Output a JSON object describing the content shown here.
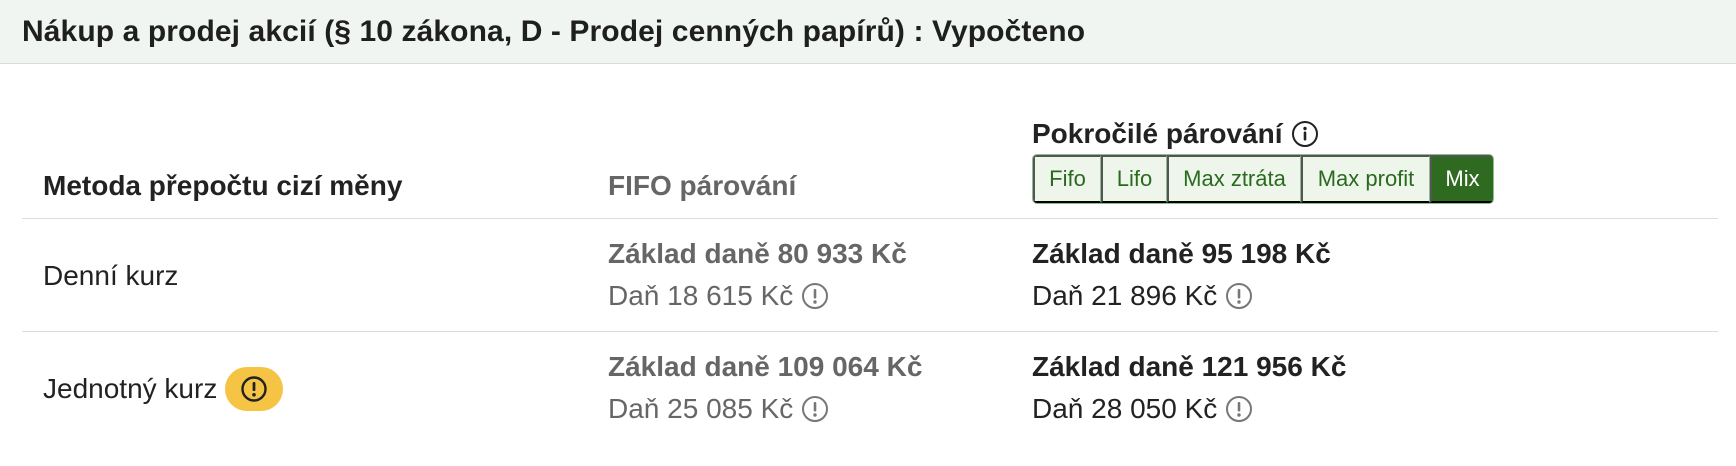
{
  "header": {
    "title": "Nákup a prodej akcií (§ 10 zákona, D - Prodej cenných papírů) : Vypočteno"
  },
  "table": {
    "col_method": "Metoda přepočtu cizí měny",
    "col_fifo": "FIFO párování",
    "col_advanced": "Pokročilé párování",
    "advanced_info_icon": "info-icon",
    "pairing_options": [
      {
        "label": "Fifo",
        "active": false
      },
      {
        "label": "Lifo",
        "active": false
      },
      {
        "label": "Max ztráta",
        "active": false
      },
      {
        "label": "Max profit",
        "active": false
      },
      {
        "label": "Mix",
        "active": true
      }
    ],
    "rows": [
      {
        "label": "Denní kurz",
        "warning": false,
        "fifo_base": "Základ daně 80 933 Kč",
        "fifo_tax": "Daň 18 615 Kč",
        "adv_base": "Základ daně 95 198 Kč",
        "adv_tax": "Daň 21 896 Kč"
      },
      {
        "label": "Jednotný kurz",
        "warning": true,
        "fifo_base": "Základ daně 109 064 Kč",
        "fifo_tax": "Daň 25 085 Kč",
        "adv_base": "Základ daně 121 956 Kč",
        "adv_tax": "Daň 28 050 Kč"
      }
    ]
  },
  "colors": {
    "header_bg": "#f1f5f2",
    "accent_green": "#2e6b21",
    "button_bg": "#eef6ec",
    "warning_yellow": "#f6c445",
    "muted_text": "#666666"
  }
}
